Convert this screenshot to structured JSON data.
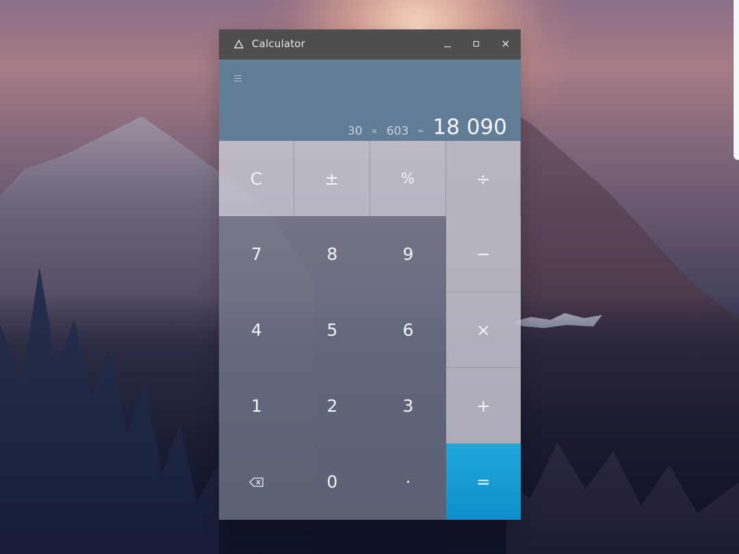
{
  "window": {
    "title": "Calculator",
    "icons": {
      "app": "triangle-icon",
      "minimize": "minimize-icon",
      "maximize": "maximize-icon",
      "close": "close-icon",
      "menu": "menu-icon",
      "backspace": "backspace-icon"
    }
  },
  "display": {
    "operand_1": "30",
    "operator": "×",
    "operand_2": "603",
    "equals_sign": "=",
    "result": "18 090"
  },
  "keypad": {
    "clear": "C",
    "negate": "±",
    "percent": "%",
    "divide": "÷",
    "seven": "7",
    "eight": "8",
    "nine": "9",
    "subtract": "−",
    "four": "4",
    "five": "5",
    "six": "6",
    "multiply": "×",
    "one": "1",
    "two": "2",
    "three": "3",
    "add": "+",
    "zero": "0",
    "decimal": "·",
    "equals": "="
  }
}
